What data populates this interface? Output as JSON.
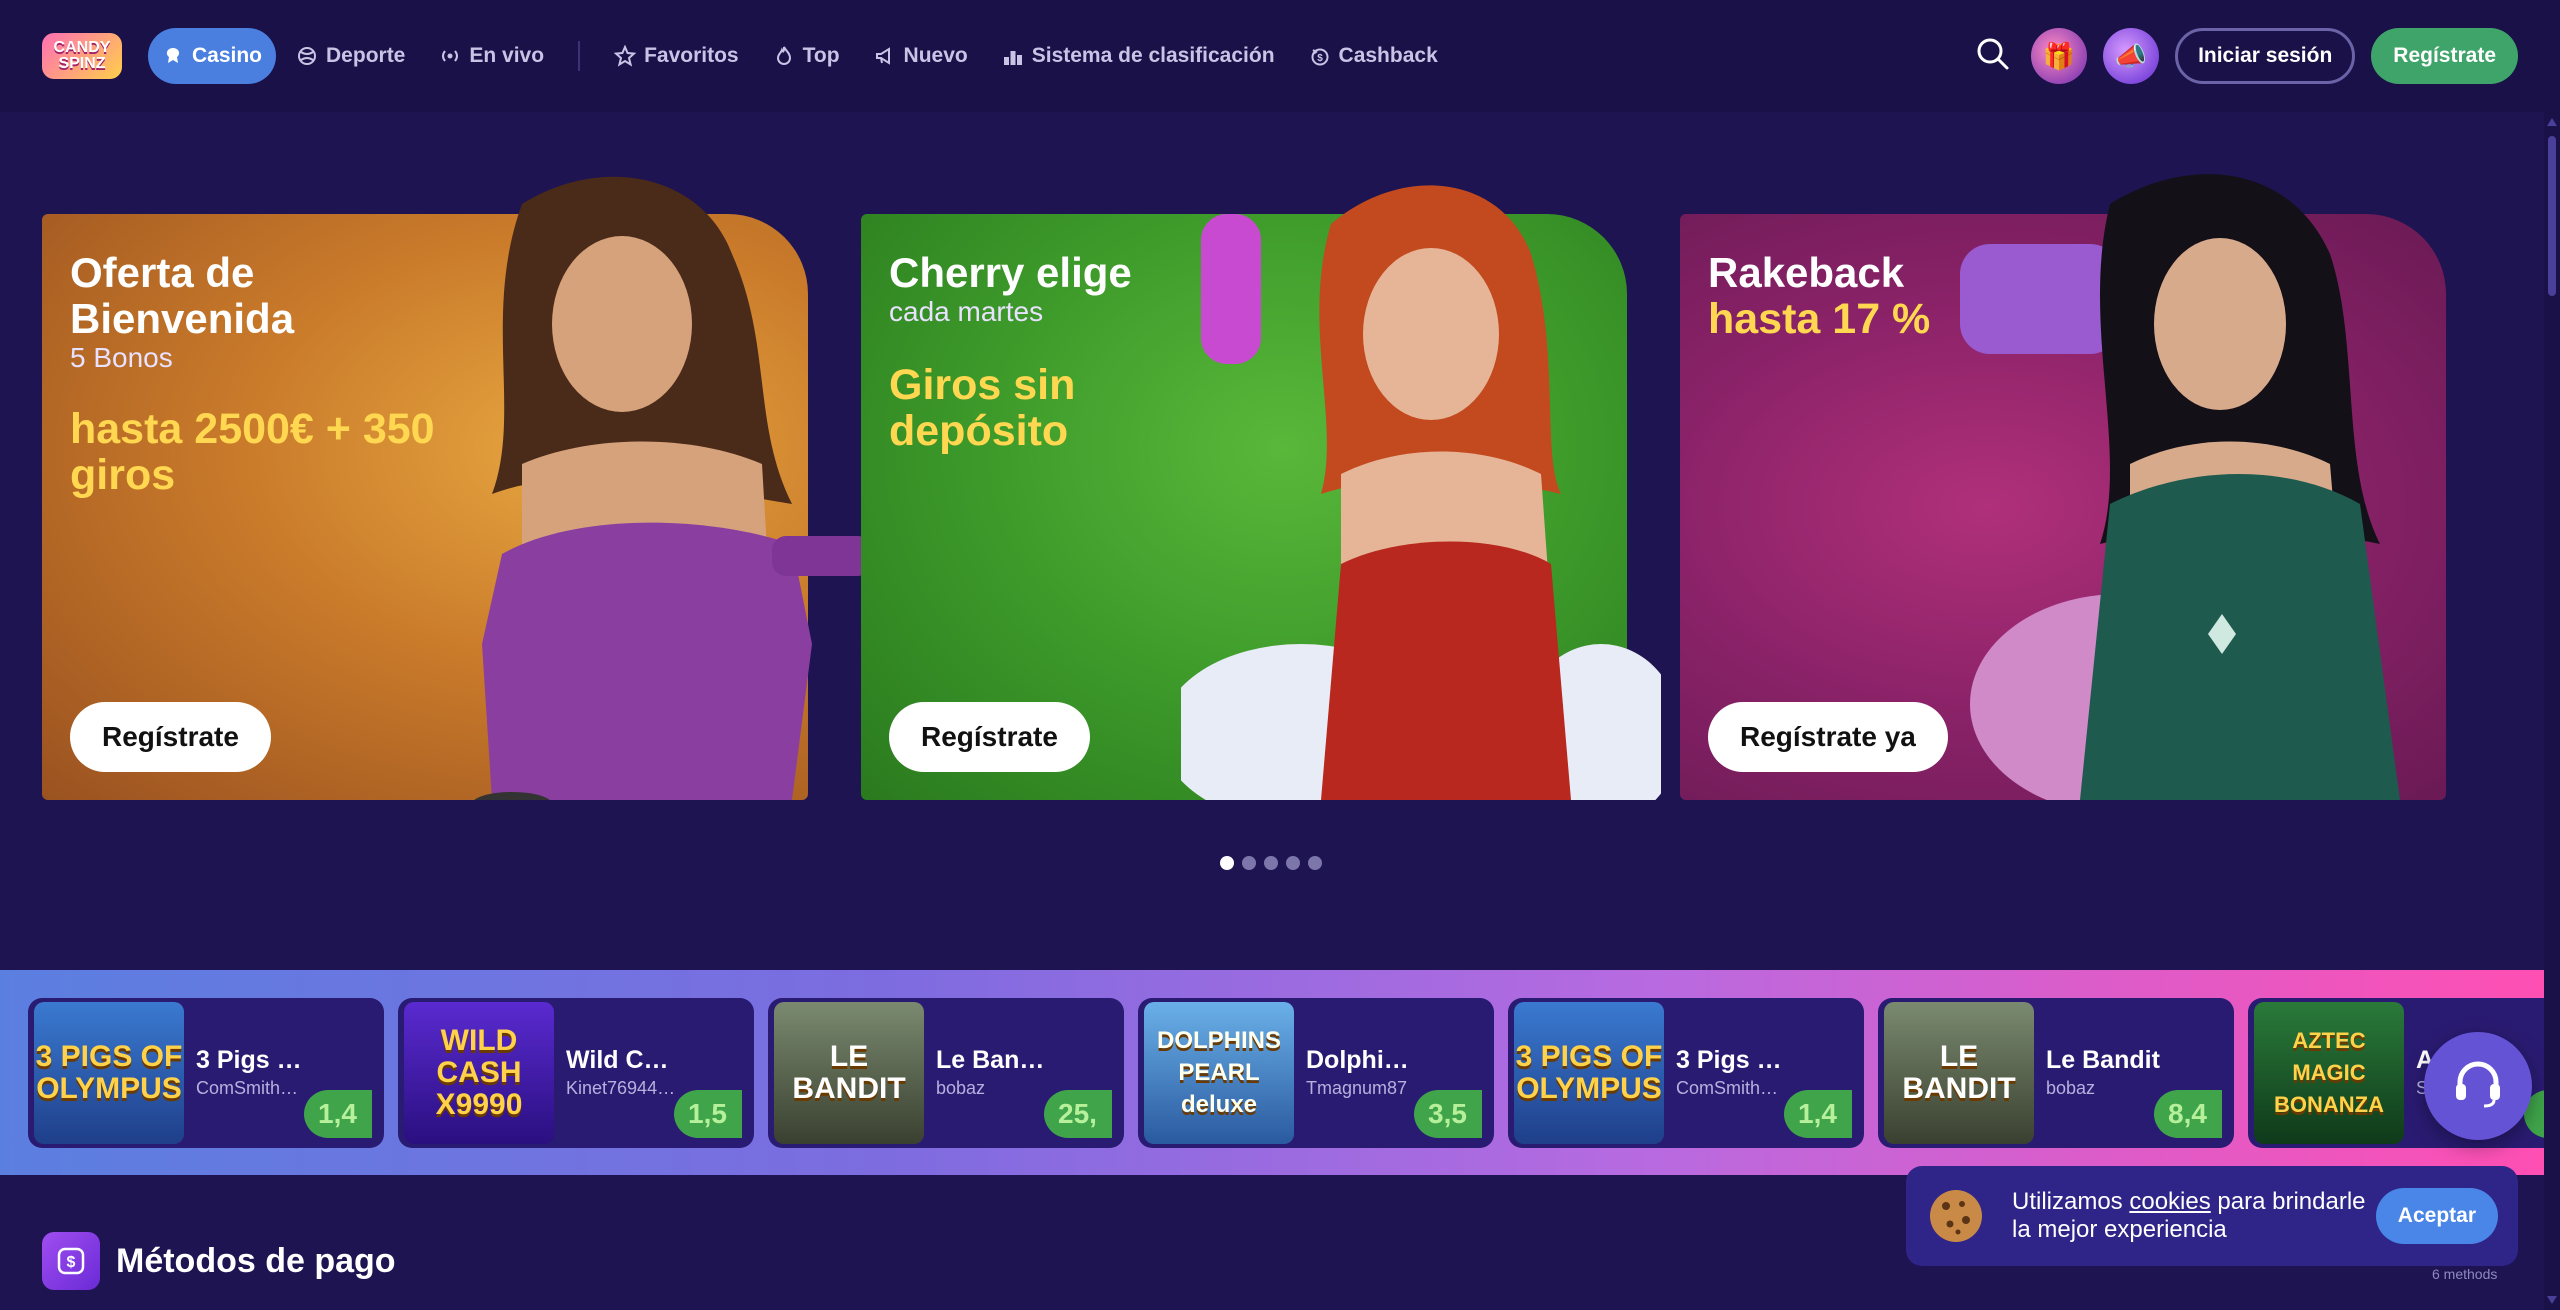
{
  "header": {
    "logo_text": "CANDY SPINZ",
    "nav": [
      {
        "label": "Casino",
        "icon": "candy-icon",
        "active": true
      },
      {
        "label": "Deporte",
        "icon": "ball-icon"
      },
      {
        "label": "En vivo",
        "icon": "live-icon"
      },
      {
        "label": "Favoritos",
        "icon": "star-icon"
      },
      {
        "label": "Top",
        "icon": "fire-icon"
      },
      {
        "label": "Nuevo",
        "icon": "megaphone-icon"
      },
      {
        "label": "Sistema de clasificación",
        "icon": "ranking-icon"
      },
      {
        "label": "Cashback",
        "icon": "cashback-icon"
      }
    ],
    "login_label": "Iniciar sesión",
    "register_label": "Regístrate"
  },
  "banners": [
    {
      "title": "Oferta de Bienvenida",
      "subtitle": "5 Bonos",
      "offer": "hasta 2500€ + 350 giros",
      "button": "Regístrate"
    },
    {
      "title": "Cherry elige",
      "subtitle": "cada martes",
      "offer": "Giros sin depósito",
      "button": "Regístrate"
    },
    {
      "title": "Rakeback",
      "subtitle": "",
      "offer": "hasta 17 %",
      "button": "Regístrate ya"
    }
  ],
  "carousel": {
    "total_dots": 5,
    "active_index": 0
  },
  "winners": [
    {
      "game": "3 Pigs …",
      "user": "ComSmith…",
      "amount": "1,4",
      "thumb": "3 PIGS OF OLYMPUS"
    },
    {
      "game": "Wild C…",
      "user": "Kinet76944…",
      "amount": "1,5",
      "thumb": "WILD CASH X9990"
    },
    {
      "game": "Le Ban…",
      "user": "bobaz",
      "amount": "25,",
      "thumb": "LE BANDIT"
    },
    {
      "game": "Dolphi…",
      "user": "Tmagnum87",
      "amount": "3,5",
      "thumb": "DOLPHINS PEARL deluxe"
    },
    {
      "game": "3 Pigs …",
      "user": "ComSmith…",
      "amount": "1,4",
      "thumb": "3 PIGS OF OLYMPUS"
    },
    {
      "game": "Le Bandit",
      "user": "bobaz",
      "amount": "8,4",
      "thumb": "LE BANDIT"
    },
    {
      "game": "A…",
      "user": "S…",
      "amount": "",
      "thumb": "AZTEC MAGIC BONANZA"
    }
  ],
  "payment": {
    "title": "Métodos de pago",
    "count_label": "6 methods"
  },
  "cookie": {
    "text_before": "Utilizamos ",
    "link": "cookies",
    "text_after": " para brindarle la mejor experiencia",
    "button": "Aceptar"
  },
  "colors": {
    "background": "#1e1452",
    "header": "#1a1148",
    "accent_blue": "#4a7fe0",
    "register_green": "#3fa46a",
    "offer_yellow": "#ffd750"
  }
}
